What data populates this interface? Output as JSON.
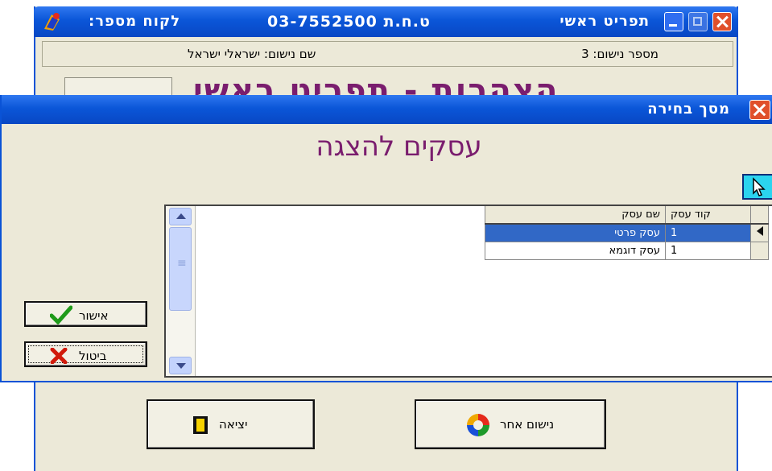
{
  "main_window": {
    "title": "תפריט ראשי",
    "phone": "ט.ח.ת 03-7552500",
    "customer_label": "לקוח מספר:",
    "info": {
      "install_name": "שם נישום: ישראלי ישראל",
      "install_number": "מספר נישום: 3"
    },
    "heading": "הצהרות - תפריט ראשי",
    "buttons": {
      "exit": "יציאה",
      "other_taxpayer": "נישום אחר"
    }
  },
  "dialog": {
    "title": "מסך בחירה",
    "heading": "עסקים להצגה",
    "grid": {
      "columns": [
        "קוד עסק",
        "שם עסק"
      ],
      "rows": [
        {
          "code": "1",
          "name": "עסק פרטי",
          "selected": true
        },
        {
          "code": "1",
          "name": "עסק דוגמא",
          "selected": false
        }
      ]
    },
    "buttons": {
      "ok": "אישור",
      "cancel": "ביטול"
    }
  },
  "colors": {
    "titlebar": "#0b56d8",
    "heading": "#7a1d6e",
    "selection": "#3168c6",
    "window_bg": "#ece9d8"
  }
}
